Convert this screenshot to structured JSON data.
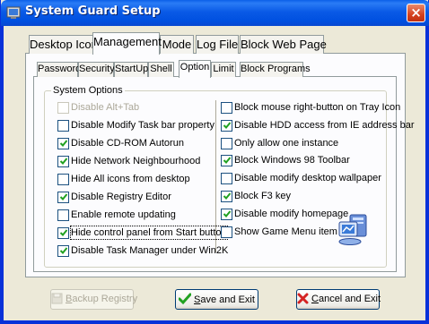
{
  "window": {
    "title": "System Guard Setup",
    "close_symbol": "×"
  },
  "main_tabs": [
    {
      "label": "Desktop Icon",
      "active": false
    },
    {
      "label": "Management",
      "active": true
    },
    {
      "label": "Mode",
      "active": false
    },
    {
      "label": "Log File",
      "active": false
    },
    {
      "label": "Block Web Page",
      "active": false
    }
  ],
  "sub_tabs": [
    {
      "label": "Password",
      "active": false
    },
    {
      "label": "Security",
      "active": false
    },
    {
      "label": "StartUp",
      "active": false
    },
    {
      "label": "Shell",
      "active": false
    },
    {
      "label": "Option",
      "active": true
    },
    {
      "label": "Limit",
      "active": false
    },
    {
      "label": "Block Programs",
      "active": false
    }
  ],
  "group": {
    "label": "System Options",
    "left_options": [
      {
        "label": "Disable Alt+Tab",
        "checked": false,
        "disabled": true
      },
      {
        "label": "Disable Modify Task bar property",
        "checked": false,
        "disabled": false
      },
      {
        "label": "Disable CD-ROM Autorun",
        "checked": true,
        "disabled": false
      },
      {
        "label": "Hide Network Neighbourhood",
        "checked": true,
        "disabled": false
      },
      {
        "label": "Hide All icons from desktop",
        "checked": false,
        "disabled": false
      },
      {
        "label": "Disable Registry Editor",
        "checked": true,
        "disabled": false
      },
      {
        "label": "Enable remote updating",
        "checked": false,
        "disabled": false
      },
      {
        "label": "Hide control panel from Start button",
        "checked": true,
        "disabled": false,
        "focused": true
      },
      {
        "label": "Disable Task Manager under Win2K",
        "checked": true,
        "disabled": false
      }
    ],
    "right_options": [
      {
        "label": "Block mouse right-button on Tray Icon",
        "checked": false,
        "disabled": false
      },
      {
        "label": "Disable HDD access from IE address bar",
        "checked": true,
        "disabled": false
      },
      {
        "label": "Only allow one instance",
        "checked": false,
        "disabled": false
      },
      {
        "label": "Block Windows 98 Toolbar",
        "checked": true,
        "disabled": false
      },
      {
        "label": "Disable modify desktop wallpaper",
        "checked": false,
        "disabled": false
      },
      {
        "label": "Block F3 key",
        "checked": true,
        "disabled": false
      },
      {
        "label": "Disable modify homepage",
        "checked": true,
        "disabled": false
      },
      {
        "label": "Show Game Menu item",
        "checked": false,
        "disabled": false
      }
    ]
  },
  "buttons": {
    "backup": {
      "label": "Backup Registry",
      "mnemonic": "B",
      "rest": "ackup Registry",
      "disabled": true
    },
    "save": {
      "label": "Save and Exit",
      "mnemonic": "S",
      "rest": "ave and Exit"
    },
    "cancel": {
      "label": "Cancel and Exit",
      "mnemonic": "C",
      "rest": "ancel and Exit"
    }
  },
  "colors": {
    "titlebar": "#0a5ae6",
    "check_mark": "#21a121",
    "close_red": "#d5411e",
    "cancel_x": "#d42323",
    "save_check": "#21a121"
  },
  "icons": {
    "app": "app-shield-icon",
    "close": "close-icon",
    "save": "green-check-icon",
    "cancel": "red-x-icon",
    "backup": "disk-icon",
    "decor": "computer-icon"
  }
}
